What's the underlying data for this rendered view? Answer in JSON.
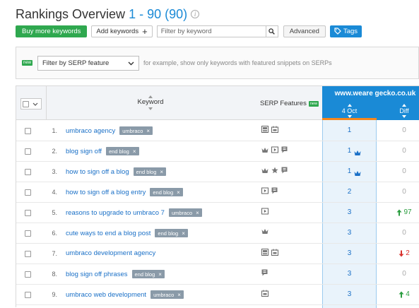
{
  "header": {
    "title": "Rankings Overview",
    "range": "1 - 90 (90)",
    "info_glyph": "i"
  },
  "toolbar": {
    "buy_more_label": "Buy more keywords",
    "add_keywords_label": "Add keywords",
    "search_placeholder": "Filter by keyword",
    "advanced_label": "Advanced",
    "tags_label": "Tags"
  },
  "filter": {
    "new_badge": "new",
    "serp_select_value": "Filter by SERP feature",
    "hint": "for example, show only keywords with featured snippets on SERPs"
  },
  "table": {
    "col_keyword": "Keyword",
    "col_serp": "SERP Features",
    "col_serp_badge": "new",
    "domain": "www.weare gecko.co.uk",
    "col_date": "4 Oct",
    "col_diff": "Diff",
    "rows": [
      {
        "num": "1.",
        "keyword": "umbraco agency",
        "tag": "umbraco",
        "serp": [
          "image-pack-icon",
          "reviews-icon"
        ],
        "pos": "1",
        "crown": false,
        "diff": "0",
        "diff_dir": "zero"
      },
      {
        "num": "2.",
        "keyword": "blog sign off",
        "tag": "end blog",
        "serp": [
          "crown-icon",
          "video-icon",
          "snippet-icon"
        ],
        "pos": "1",
        "crown": true,
        "diff": "0",
        "diff_dir": "zero"
      },
      {
        "num": "3.",
        "keyword": "how to sign off a blog",
        "tag": "end blog",
        "serp": [
          "crown-icon",
          "star-icon",
          "snippet-icon"
        ],
        "pos": "1",
        "crown": true,
        "diff": "0",
        "diff_dir": "zero"
      },
      {
        "num": "4.",
        "keyword": "how to sign off a blog entry",
        "tag": "end blog",
        "serp": [
          "video-icon",
          "snippet-icon"
        ],
        "pos": "2",
        "crown": false,
        "diff": "0",
        "diff_dir": "zero"
      },
      {
        "num": "5.",
        "keyword": "reasons to upgrade to umbraco 7",
        "tag": "umbraco",
        "serp": [
          "video-icon"
        ],
        "pos": "3",
        "crown": false,
        "diff": "97",
        "diff_dir": "up"
      },
      {
        "num": "6.",
        "keyword": "cute ways to end a blog post",
        "tag": "end blog",
        "serp": [
          "crown-icon"
        ],
        "pos": "3",
        "crown": false,
        "diff": "0",
        "diff_dir": "zero"
      },
      {
        "num": "7.",
        "keyword": "umbraco development agency",
        "tag": "",
        "serp": [
          "image-pack-icon",
          "reviews-icon"
        ],
        "pos": "3",
        "crown": false,
        "diff": "2",
        "diff_dir": "down"
      },
      {
        "num": "8.",
        "keyword": "blog sign off phrases",
        "tag": "end blog",
        "serp": [
          "snippet-icon"
        ],
        "pos": "3",
        "crown": false,
        "diff": "0",
        "diff_dir": "zero"
      },
      {
        "num": "9.",
        "keyword": "umbraco web development",
        "tag": "umbraco",
        "serp": [
          "reviews-icon"
        ],
        "pos": "3",
        "crown": false,
        "diff": "4",
        "diff_dir": "up"
      }
    ]
  },
  "colors": {
    "accent": "#1a8ad6",
    "green": "#2fa84f",
    "orange": "#f5871f",
    "up": "#2a9d3f",
    "down": "#d8312c"
  }
}
